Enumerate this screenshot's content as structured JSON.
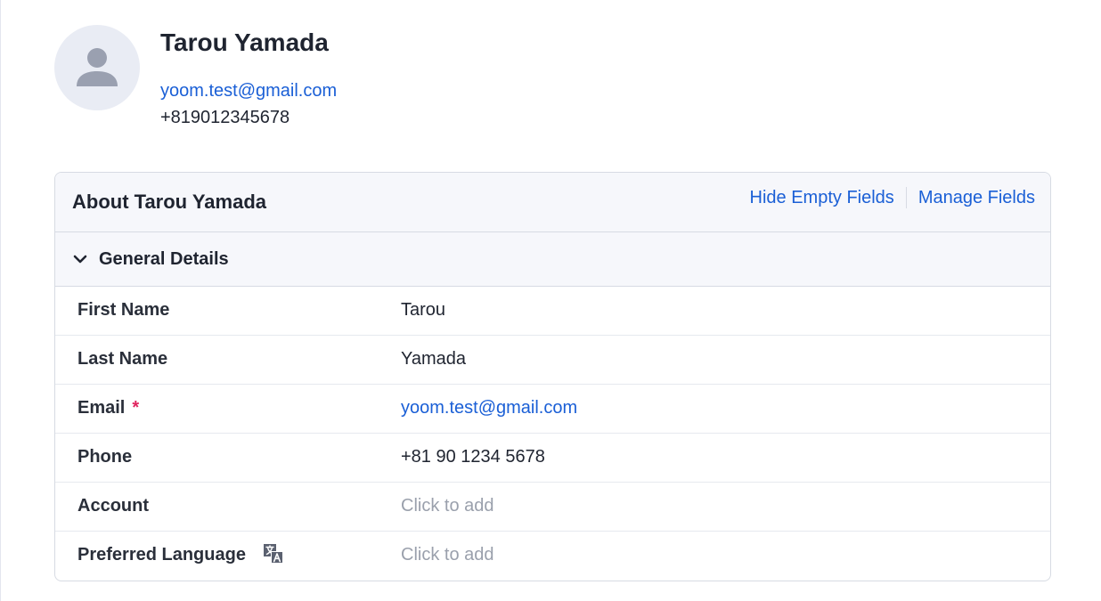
{
  "profile": {
    "name": "Tarou Yamada",
    "email": "yoom.test@gmail.com",
    "phone": "+819012345678"
  },
  "card": {
    "title": "About Tarou Yamada",
    "hide_empty_label": "Hide Empty Fields",
    "manage_fields_label": "Manage Fields"
  },
  "section": {
    "title": "General Details",
    "icon": "chevron-down-icon"
  },
  "fields": [
    {
      "label": "First Name",
      "value": "Tarou",
      "kind": "text"
    },
    {
      "label": "Last Name",
      "value": "Yamada",
      "kind": "text"
    },
    {
      "label": "Email",
      "required_mark": "*",
      "value": "yoom.test@gmail.com",
      "kind": "link"
    },
    {
      "label": "Phone",
      "value": "+81 90 1234 5678",
      "kind": "text"
    },
    {
      "label": "Account",
      "value": "Click to add",
      "kind": "placeholder"
    },
    {
      "label": "Preferred Language",
      "value": "Click to add",
      "kind": "placeholder",
      "icon": "translate-icon"
    }
  ],
  "colors": {
    "link": "#1a5fd6",
    "required": "#e0245e",
    "placeholder": "#9aa0ac",
    "header_bg": "#f6f7fb",
    "avatar_bg": "#e9ecf4"
  }
}
